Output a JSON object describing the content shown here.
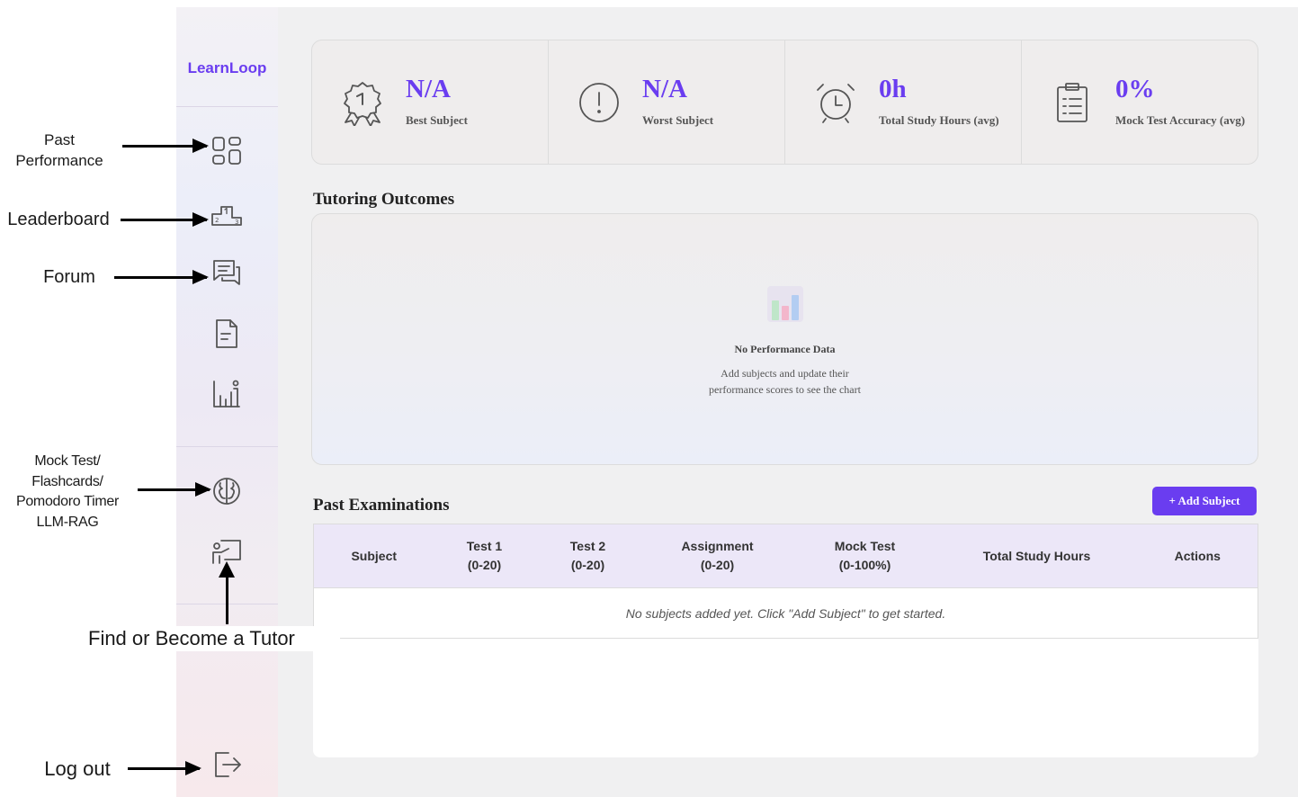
{
  "annotations": {
    "past_performance": "Past\nPerformance",
    "leaderboard": "Leaderboard",
    "forum": "Forum",
    "mock_test": "Mock Test/\nFlashcards/\nPomodoro Timer\nLLM-RAG",
    "find_tutor": "Find or Become a Tutor",
    "log_out": "Log out"
  },
  "sidebar": {
    "brand": "LearnLoop",
    "items": [
      {
        "icon": "dashboard-grid-icon"
      },
      {
        "icon": "podium-icon"
      },
      {
        "icon": "chat-bubbles-icon"
      },
      {
        "icon": "document-icon"
      },
      {
        "icon": "chart-person-icon"
      },
      {
        "icon": "brain-icon"
      },
      {
        "icon": "tutor-board-icon"
      },
      {
        "icon": "logout-icon"
      }
    ]
  },
  "stats": [
    {
      "value": "N/A",
      "label": "Best Subject",
      "icon": "award-icon"
    },
    {
      "value": "N/A",
      "label": "Worst Subject",
      "icon": "alert-circle-icon"
    },
    {
      "value": "0h",
      "label": "Total Study Hours (avg)",
      "icon": "alarm-clock-icon"
    },
    {
      "value": "0%",
      "label": "Mock Test Accuracy (avg)",
      "icon": "clipboard-icon"
    }
  ],
  "outcomes": {
    "title": "Tutoring Outcomes",
    "empty_title": "No Performance Data",
    "empty_sub": "Add subjects and update their performance scores to see the chart"
  },
  "exams": {
    "title": "Past Examinations",
    "add_button": "+ Add Subject",
    "columns": [
      {
        "line1": "Subject",
        "line2": ""
      },
      {
        "line1": "Test 1",
        "line2": "(0-20)"
      },
      {
        "line1": "Test 2",
        "line2": "(0-20)"
      },
      {
        "line1": "Assignment",
        "line2": "(0-20)"
      },
      {
        "line1": "Mock Test",
        "line2": "(0-100%)"
      },
      {
        "line1": "Total Study Hours",
        "line2": ""
      },
      {
        "line1": "Actions",
        "line2": ""
      }
    ],
    "empty_message": "No subjects added yet. Click \"Add Subject\" to get started."
  },
  "colors": {
    "accent": "#6a3df0",
    "icon": "#555555"
  }
}
